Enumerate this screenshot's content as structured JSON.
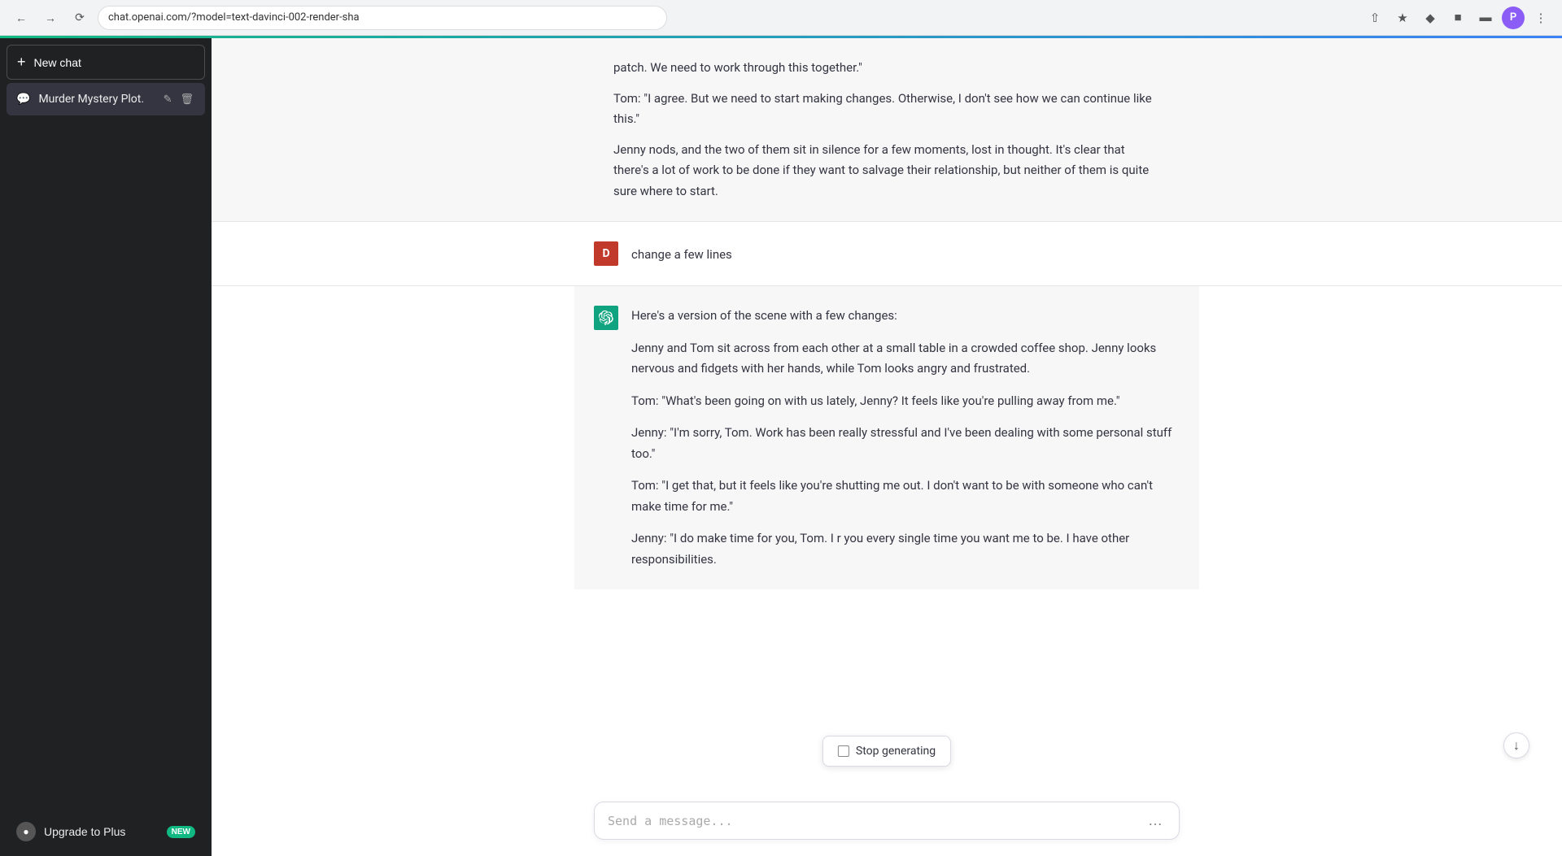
{
  "browser": {
    "url": "chat.openai.com/?model=text-davinci-002-render-sha",
    "profile_letter": "P"
  },
  "sidebar": {
    "new_chat_label": "New chat",
    "chat_item_label": "Murder Mystery Plot.",
    "upgrade_label": "Upgrade to Plus",
    "upgrade_badge": "NEW"
  },
  "prev_message": {
    "para1": "patch. We need to work through this together.\"",
    "para2": "Tom: \"I agree. But we need to start making changes. Otherwise, I don't see how we can continue like this.\"",
    "para3": "Jenny nods, and the two of them sit in silence for a few moments, lost in thought. It's clear that there's a lot of work to be done if they want to salvage their relationship, but neither of them is quite sure where to start."
  },
  "user_message": {
    "avatar_letter": "D",
    "text": "change a few lines"
  },
  "ai_message": {
    "intro": "Here's a version of the scene with a few changes:",
    "para1": "Jenny and Tom sit across from each other at a small table in a crowded coffee shop. Jenny looks nervous and fidgets with her hands, while Tom looks angry and frustrated.",
    "para2": "Tom: \"What's been going on with us lately, Jenny? It feels like you're pulling away from me.\"",
    "para3": "Jenny: \"I'm sorry, Tom. Work has been really stressful and I've been dealing with some personal stuff too.\"",
    "para4": "Tom: \"I get that, but it feels like you're shutting me out. I don't want to be with someone who can't make time for me.\"",
    "para5": "Jenny: \"I do make time for you, Tom. I r you every single time you want me to be. I have other responsibilities."
  },
  "input": {
    "placeholder": "Send a message..."
  },
  "stop_generating": {
    "label": "Stop generating"
  },
  "scroll_down": "↓"
}
